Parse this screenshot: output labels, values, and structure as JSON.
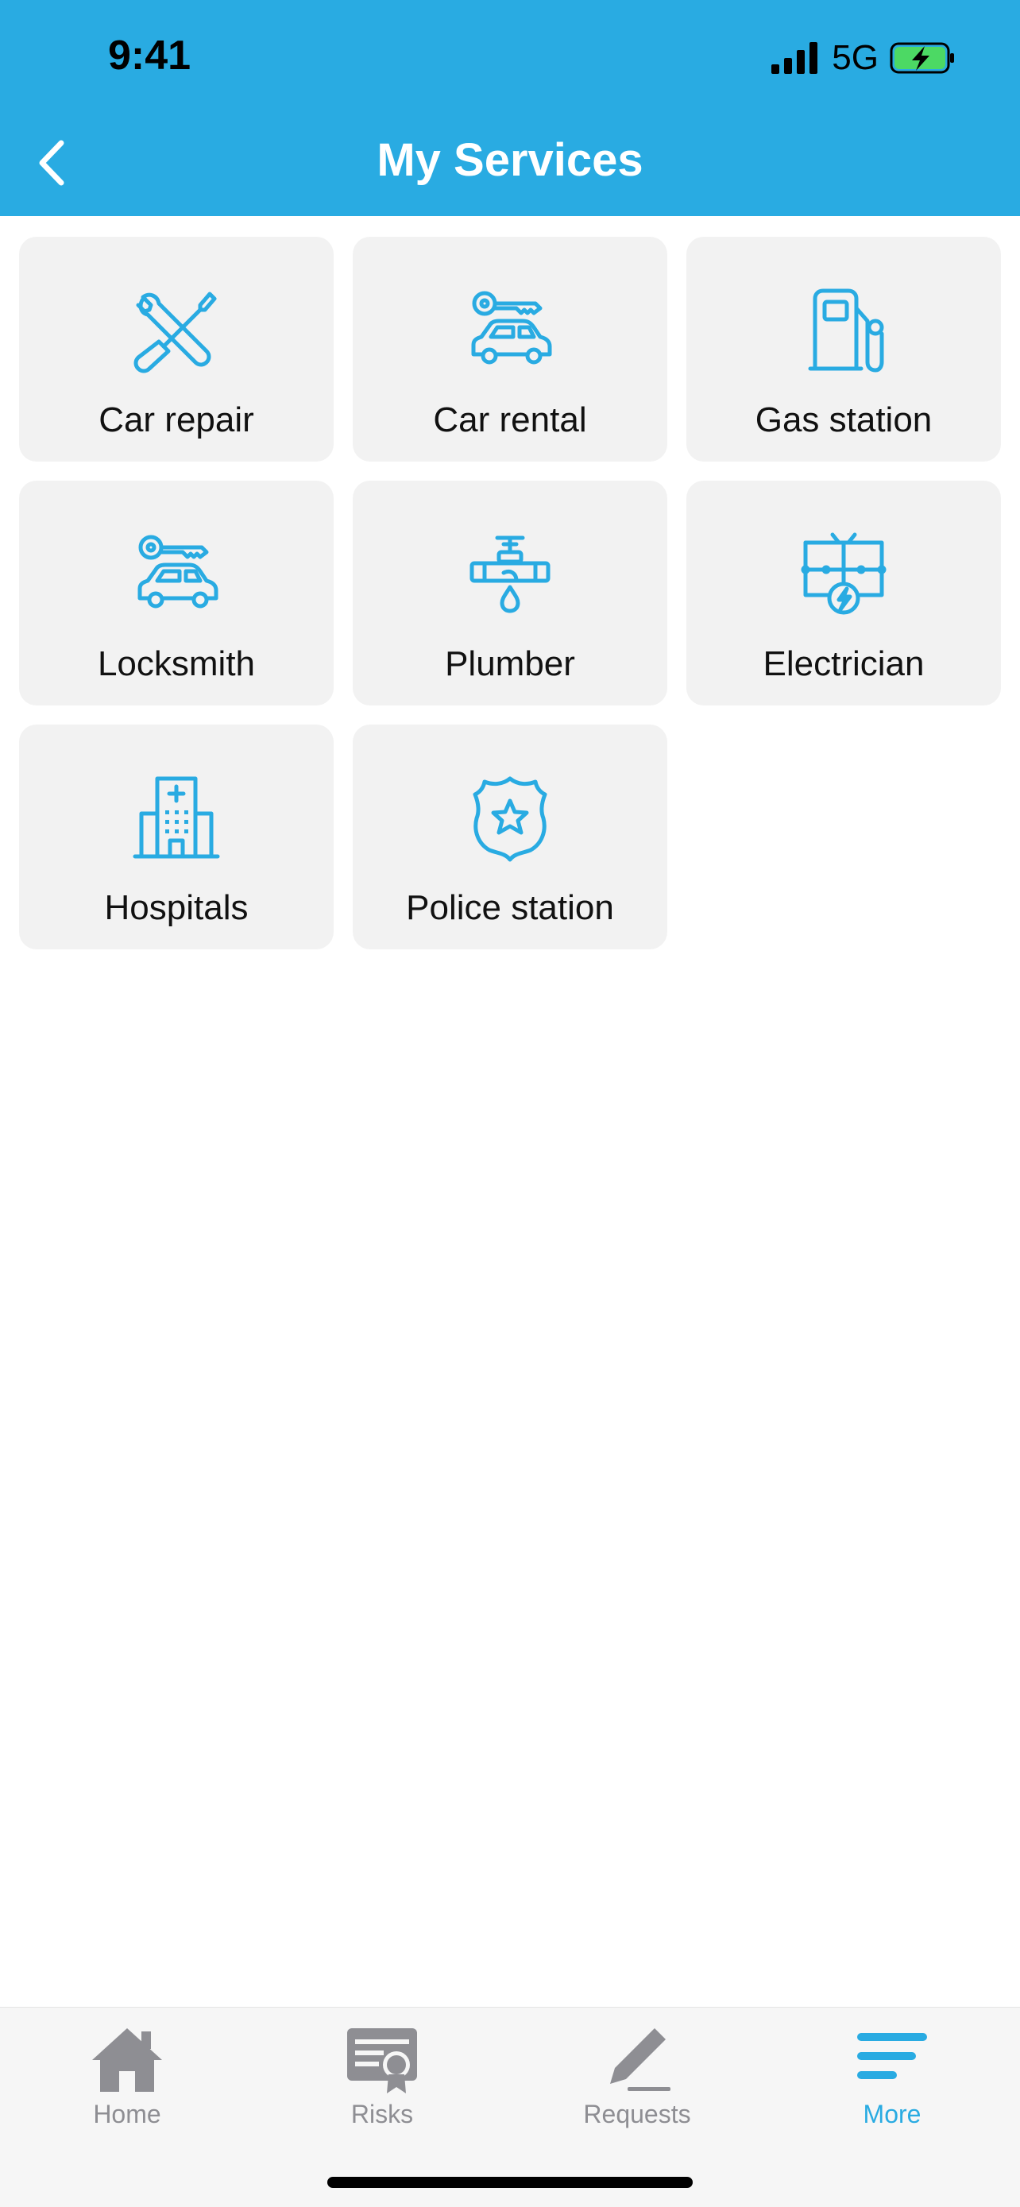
{
  "status_bar": {
    "time": "9:41",
    "network": "5G"
  },
  "header": {
    "title": "My Services",
    "back_icon": "chevron-left-icon"
  },
  "colors": {
    "accent": "#29ABE2",
    "tile_bg": "#F2F2F2",
    "tab_inactive": "#8E8E93",
    "battery_fill": "#4CD964"
  },
  "services": [
    {
      "label": "Car repair",
      "icon": "wrench-screwdriver-icon"
    },
    {
      "label": "Car rental",
      "icon": "car-key-icon"
    },
    {
      "label": "Gas station",
      "icon": "fuel-pump-icon"
    },
    {
      "label": "Locksmith",
      "icon": "car-key-icon"
    },
    {
      "label": "Plumber",
      "icon": "faucet-icon"
    },
    {
      "label": "Electrician",
      "icon": "electric-circuit-icon"
    },
    {
      "label": "Hospitals",
      "icon": "hospital-icon"
    },
    {
      "label": "Police station",
      "icon": "police-badge-icon"
    }
  ],
  "tabbar": {
    "items": [
      {
        "label": "Home",
        "icon": "home-icon"
      },
      {
        "label": "Risks",
        "icon": "certificate-icon"
      },
      {
        "label": "Requests",
        "icon": "pencil-icon"
      },
      {
        "label": "More",
        "icon": "menu-icon"
      }
    ],
    "active": "More"
  }
}
